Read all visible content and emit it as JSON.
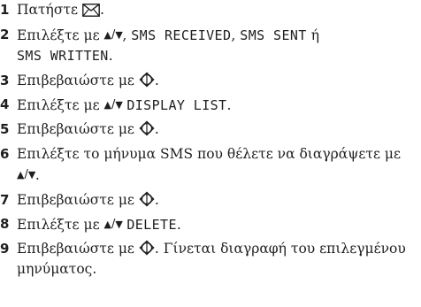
{
  "steps": [
    {
      "num": "1",
      "text": "Πατήστε",
      "end": "."
    },
    {
      "num": "2",
      "text": "Επιλέξτε με",
      "sep1": ",",
      "lcd1": "SMS RECEIVED",
      "sep2": ",",
      "lcd2": "SMS SENT",
      "or": "ή",
      "lcd3": "SMS WRITTEN",
      "end": "."
    },
    {
      "num": "3",
      "text": "Επιβεβαιώστε με",
      "end": "."
    },
    {
      "num": "4",
      "text": "Επιλέξτε με",
      "lcd1": "DISPLAY LIST",
      "end": "."
    },
    {
      "num": "5",
      "text": "Επιβεβαιώστε με",
      "end": "."
    },
    {
      "num": "6",
      "text": "Επιλέξτε το μήνυμα SMS που θέλετε να διαγράψετε με",
      "end": "."
    },
    {
      "num": "7",
      "text": "Επιβεβαιώστε με",
      "end": "."
    },
    {
      "num": "8",
      "text": "Επιλέξτε με",
      "lcd1": "DELETE",
      "end": "."
    },
    {
      "num": "9",
      "text": "Επιβεβαιώστε με",
      "end": ".",
      "text2": "Γίνεται διαγραφή του επιλεγμένου μηνύματος."
    }
  ],
  "icons": {
    "envelope": "envelope-icon",
    "navigation": "up-down-arrows-icon",
    "confirm": "ok-key-icon"
  }
}
